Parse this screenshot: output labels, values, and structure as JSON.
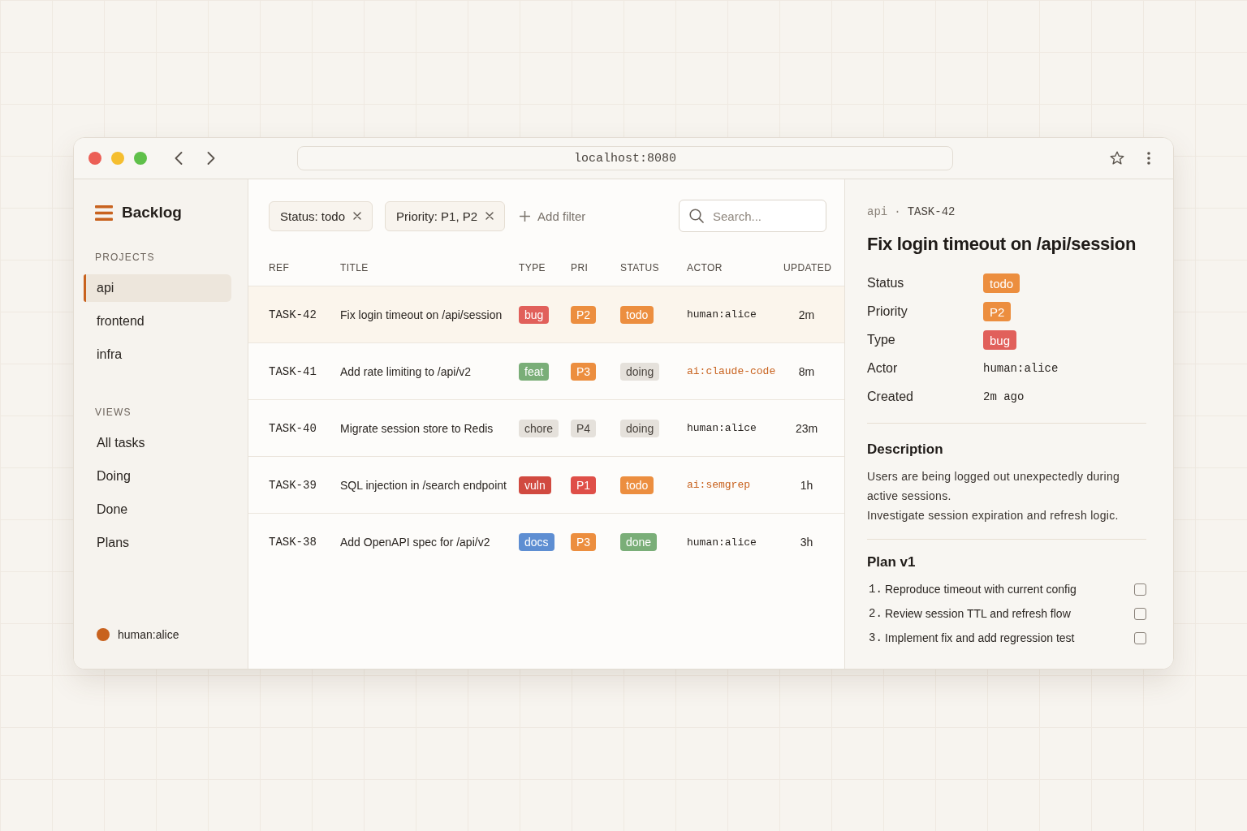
{
  "window": {
    "address": "localhost:8080"
  },
  "sidebar": {
    "title": "Backlog",
    "sections": [
      {
        "label": "PROJECTS",
        "items": [
          {
            "label": "api",
            "selected": true
          },
          {
            "label": "frontend",
            "selected": false
          },
          {
            "label": "infra",
            "selected": false
          }
        ]
      },
      {
        "label": "VIEWS",
        "items": [
          {
            "label": "All tasks",
            "selected": false
          },
          {
            "label": "Doing",
            "selected": false
          },
          {
            "label": "Done",
            "selected": false
          },
          {
            "label": "Plans",
            "selected": false
          }
        ]
      }
    ],
    "user": "human:alice"
  },
  "filters": {
    "chips": [
      "Status: todo",
      "Priority: P1, P2"
    ],
    "add_filter": "Add filter",
    "search": {
      "placeholder": "Search..."
    }
  },
  "table": {
    "columns": [
      "REF",
      "TITLE",
      "TYPE",
      "PRI",
      "STATUS",
      "ACTOR",
      "UPDATED"
    ],
    "rows": [
      {
        "ref": "TASK-42",
        "title": "Fix login timeout on /api/session",
        "type": {
          "label": "bug",
          "color": "#e1605b"
        },
        "priority": {
          "label": "P2",
          "color": "#ec8e3f"
        },
        "status": {
          "label": "todo",
          "color": "#ec8e3f"
        },
        "actor": {
          "name": "human:alice",
          "kind": "human"
        },
        "updated": "2m",
        "selected": true
      },
      {
        "ref": "TASK-41",
        "title": "Add rate limiting to /api/v2",
        "type": {
          "label": "feat",
          "color": "#7aae78"
        },
        "priority": {
          "label": "P3",
          "color": "#ec8e3f"
        },
        "status": {
          "label": "doing",
          "color": "#e5e1db"
        },
        "actor": {
          "name": "ai:claude-code",
          "kind": "ai"
        },
        "updated": "8m",
        "selected": false
      },
      {
        "ref": "TASK-40",
        "title": "Migrate session store to Redis",
        "type": {
          "label": "chore",
          "color": "#e5e1db"
        },
        "priority": {
          "label": "P4",
          "color": "#e5e1db"
        },
        "status": {
          "label": "doing",
          "color": "#e5e1db"
        },
        "actor": {
          "name": "human:alice",
          "kind": "human"
        },
        "updated": "23m",
        "selected": false
      },
      {
        "ref": "TASK-39",
        "title": "SQL injection in /search endpoint",
        "type": {
          "label": "vuln",
          "color": "#d14a40"
        },
        "priority": {
          "label": "P1",
          "color": "#df4f48"
        },
        "status": {
          "label": "todo",
          "color": "#ec8e3f"
        },
        "actor": {
          "name": "ai:semgrep",
          "kind": "ai"
        },
        "updated": "1h",
        "selected": false
      },
      {
        "ref": "TASK-38",
        "title": "Add OpenAPI spec for /api/v2",
        "type": {
          "label": "docs",
          "color": "#5e8ed2"
        },
        "priority": {
          "label": "P3",
          "color": "#ec8e3f"
        },
        "status": {
          "label": "done",
          "color": "#7aae78"
        },
        "actor": {
          "name": "human:alice",
          "kind": "human"
        },
        "updated": "3h",
        "selected": false
      }
    ]
  },
  "detail": {
    "breadcrumb": {
      "project": "api",
      "separator": "·",
      "ref": "TASK-42"
    },
    "title": "Fix login timeout on /api/session",
    "fields": [
      {
        "label": "Status",
        "kind": "badge",
        "value": "todo",
        "color": "#ec8e3f"
      },
      {
        "label": "Priority",
        "kind": "badge",
        "value": "P2",
        "color": "#ec8e3f"
      },
      {
        "label": "Type",
        "kind": "badge",
        "value": "bug",
        "color": "#e1605b"
      },
      {
        "label": "Actor",
        "kind": "text",
        "value": "human:alice"
      },
      {
        "label": "Created",
        "kind": "text",
        "value": "2m ago"
      }
    ],
    "description": {
      "heading": "Description",
      "paragraphs": [
        "Users are being logged out unexpectedly during active sessions.",
        "Investigate session expiration and refresh logic."
      ]
    },
    "plan": {
      "heading": "Plan v1",
      "steps": [
        {
          "number": "1.",
          "text": "Reproduce timeout with current config",
          "checked": false
        },
        {
          "number": "2.",
          "text": "Review session TTL and refresh flow",
          "checked": false
        },
        {
          "number": "3.",
          "text": "Implement fix and add regression test",
          "checked": false
        }
      ]
    }
  }
}
